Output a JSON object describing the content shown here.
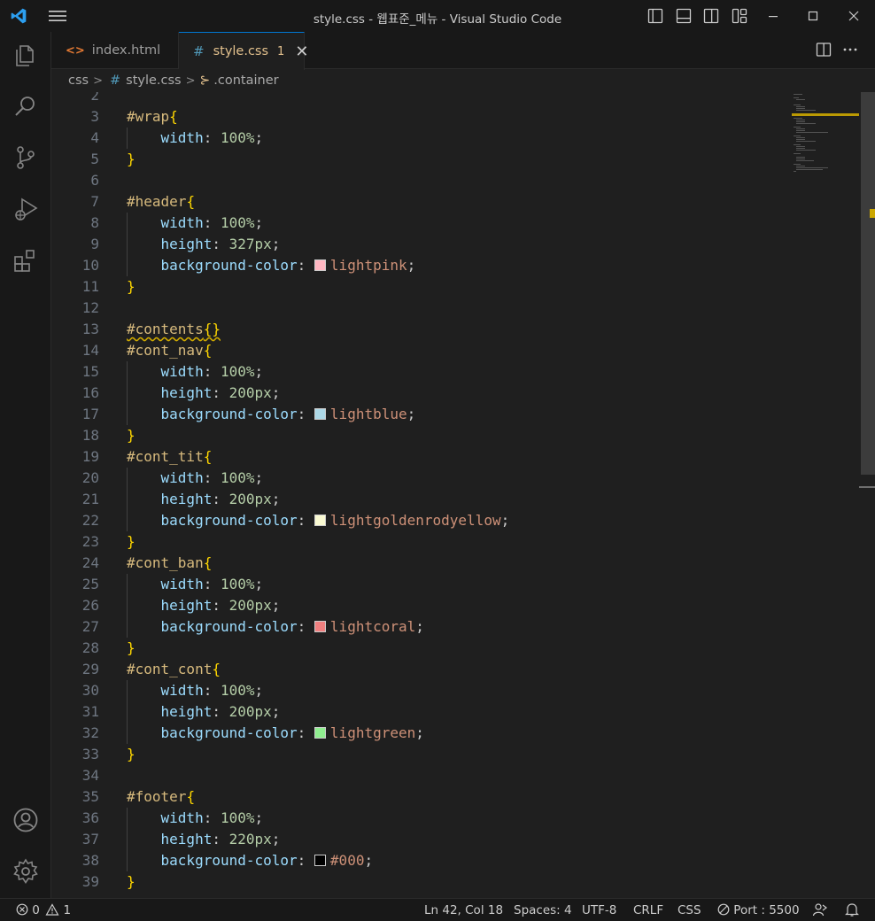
{
  "window": {
    "title": "style.css - 웹표준_메뉴 - Visual Studio Code"
  },
  "tabs": [
    {
      "label": "index.html",
      "icon": "html-file-icon",
      "active": false
    },
    {
      "label": "style.css",
      "icon": "css-file-icon",
      "active": true,
      "badge": "1",
      "close": "✕"
    }
  ],
  "breadcrumb": {
    "folder": "css",
    "file": "style.css",
    "symbol": ".container"
  },
  "colors": {
    "lightpink": "#ffb6c1",
    "lightblue": "#add8e6",
    "lightgoldenrodyellow": "#fafad2",
    "lightcoral": "#f08080",
    "lightgreen": "#90ee90",
    "black": "#000000",
    "accent": "#0078d4",
    "warning": "#cca700"
  },
  "editor": {
    "lines": [
      {
        "n": "2"
      },
      {
        "n": "3",
        "sel": "#wrap",
        "open": "{"
      },
      {
        "n": "4",
        "prop": "width",
        "num": "100%"
      },
      {
        "n": "5",
        "close": "}"
      },
      {
        "n": "6"
      },
      {
        "n": "7",
        "sel": "#header",
        "open": "{"
      },
      {
        "n": "8",
        "prop": "width",
        "num": "100%"
      },
      {
        "n": "9",
        "prop": "height",
        "num": "327px"
      },
      {
        "n": "10",
        "prop": "background-color",
        "val": "lightpink",
        "swatch": "lightpink"
      },
      {
        "n": "11",
        "close": "}"
      },
      {
        "n": "12"
      },
      {
        "n": "13",
        "sel": "#contents",
        "open": "{}",
        "squiggle": true
      },
      {
        "n": "14",
        "sel": "#cont_nav",
        "open": "{"
      },
      {
        "n": "15",
        "prop": "width",
        "num": "100%"
      },
      {
        "n": "16",
        "prop": "height",
        "num": "200px"
      },
      {
        "n": "17",
        "prop": "background-color",
        "val": "lightblue",
        "swatch": "lightblue"
      },
      {
        "n": "18",
        "close": "}"
      },
      {
        "n": "19",
        "sel": "#cont_tit",
        "open": "{"
      },
      {
        "n": "20",
        "prop": "width",
        "num": "100%"
      },
      {
        "n": "21",
        "prop": "height",
        "num": "200px"
      },
      {
        "n": "22",
        "prop": "background-color",
        "val": "lightgoldenrodyellow",
        "swatch": "lightgoldenrodyellow"
      },
      {
        "n": "23",
        "close": "}"
      },
      {
        "n": "24",
        "sel": "#cont_ban",
        "open": "{"
      },
      {
        "n": "25",
        "prop": "width",
        "num": "100%"
      },
      {
        "n": "26",
        "prop": "height",
        "num": "200px"
      },
      {
        "n": "27",
        "prop": "background-color",
        "val": "lightcoral",
        "swatch": "lightcoral"
      },
      {
        "n": "28",
        "close": "}"
      },
      {
        "n": "29",
        "sel": "#cont_cont",
        "open": "{"
      },
      {
        "n": "30",
        "prop": "width",
        "num": "100%"
      },
      {
        "n": "31",
        "prop": "height",
        "num": "200px"
      },
      {
        "n": "32",
        "prop": "background-color",
        "val": "lightgreen",
        "swatch": "lightgreen"
      },
      {
        "n": "33",
        "close": "}"
      },
      {
        "n": "34"
      },
      {
        "n": "35",
        "sel": "#footer",
        "open": "{"
      },
      {
        "n": "36",
        "prop": "width",
        "num": "100%"
      },
      {
        "n": "37",
        "prop": "height",
        "num": "220px"
      },
      {
        "n": "38",
        "prop": "background-color",
        "val": "#000",
        "swatch": "black"
      },
      {
        "n": "39",
        "close": "}"
      }
    ]
  },
  "statusbar": {
    "errors": "0",
    "warnings": "1",
    "position": "Ln 42, Col 18",
    "spaces": "Spaces: 4",
    "encoding": "UTF-8",
    "eol": "CRLF",
    "language": "CSS",
    "port": "Port : 5500"
  }
}
